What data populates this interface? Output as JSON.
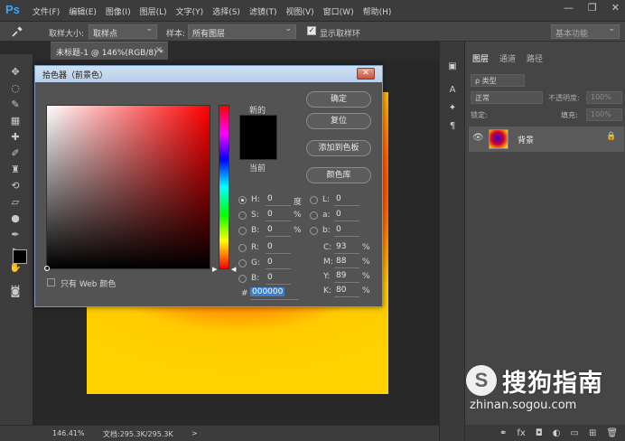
{
  "app": {
    "logo": "Ps",
    "window_controls": [
      "—",
      "❐",
      "✕"
    ]
  },
  "menu": [
    "文件(F)",
    "编辑(E)",
    "图像(I)",
    "图层(L)",
    "文字(Y)",
    "选择(S)",
    "滤镜(T)",
    "视图(V)",
    "窗口(W)",
    "帮助(H)"
  ],
  "options": {
    "tool_icon": "eyedropper-icon",
    "sample_size_label": "取样大小:",
    "sample_size_value": "取样点",
    "sample_label": "样本:",
    "sample_value": "所有图层",
    "show_ring_label": "显示取样环",
    "workspace": "基本功能"
  },
  "document": {
    "tab_title": "未标题-1 @ 146%(RGB/8) *",
    "close": "×"
  },
  "status": {
    "zoom": "146.41%",
    "doc_info": "文档:295.3K/295.3K",
    "arrow": ">"
  },
  "layers_panel": {
    "tabs": [
      "图层",
      "通道",
      "路径"
    ],
    "kind_filter": "ρ 类型",
    "blend_mode": "正常",
    "opacity_label": "不透明度:",
    "opacity_value": "100%",
    "lock_label": "锁定:",
    "fill_label": "填充:",
    "fill_value": "100%",
    "layer_name": "背景",
    "visibility": "👁",
    "lock_icon": "🔒",
    "bottom_icons": [
      "⚭",
      "fx",
      "◘",
      "◐",
      "▭",
      "⊞",
      "🗑"
    ]
  },
  "dialog": {
    "title": "拾色器（前景色）",
    "close": "✕",
    "new_label": "新的",
    "current_label": "当前",
    "buttons": {
      "ok": "确定",
      "reset": "复位",
      "add_swatch": "添加到色板",
      "color_library": "颜色库"
    },
    "hsb": {
      "H": "0",
      "S": "0",
      "B": "0",
      "H_unit": "度",
      "S_unit": "%",
      "B_unit": "%"
    },
    "rgb": {
      "R": "0",
      "G": "0",
      "B": "0"
    },
    "lab": {
      "L": "0",
      "a": "0",
      "b": "0"
    },
    "cmyk": {
      "C": "93",
      "M": "88",
      "Y": "89",
      "K": "80",
      "unit": "%"
    },
    "hex_prefix": "#",
    "hex": "000000",
    "web_only_label": "只有 Web 颜色",
    "selected_color": "#000000"
  },
  "watermark": {
    "logo": "S",
    "text": "搜狗指南",
    "url": "zhinan.sogou.com"
  }
}
